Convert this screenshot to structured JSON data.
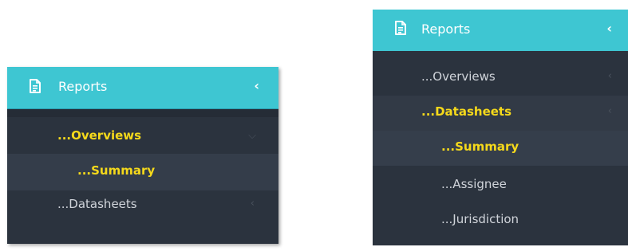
{
  "colors": {
    "header_bg": "#3ec6d2",
    "menu_bg": "#2b333e",
    "active_text": "#f5d91b",
    "inactive_text": "#d0d4da"
  },
  "left_menu": {
    "header": {
      "icon": "document-icon",
      "title": "Reports",
      "collapse_icon": "‹"
    },
    "items": [
      {
        "label": "...Overviews",
        "active": true,
        "chevron": "⌵"
      },
      {
        "label": "...Summary",
        "active": true
      },
      {
        "label": "...Datasheets",
        "active": false,
        "chevron": "‹"
      }
    ]
  },
  "right_menu": {
    "header": {
      "icon": "document-icon",
      "title": "Reports",
      "collapse_icon": "‹"
    },
    "items": [
      {
        "label": "...Overviews",
        "active": false,
        "chevron": "‹"
      },
      {
        "label": "...Datasheets",
        "active": true,
        "chevron": "‹"
      },
      {
        "label": "...Summary",
        "active": true
      },
      {
        "label": "...Assignee",
        "active": false
      },
      {
        "label": "...Jurisdiction",
        "active": false
      }
    ]
  }
}
